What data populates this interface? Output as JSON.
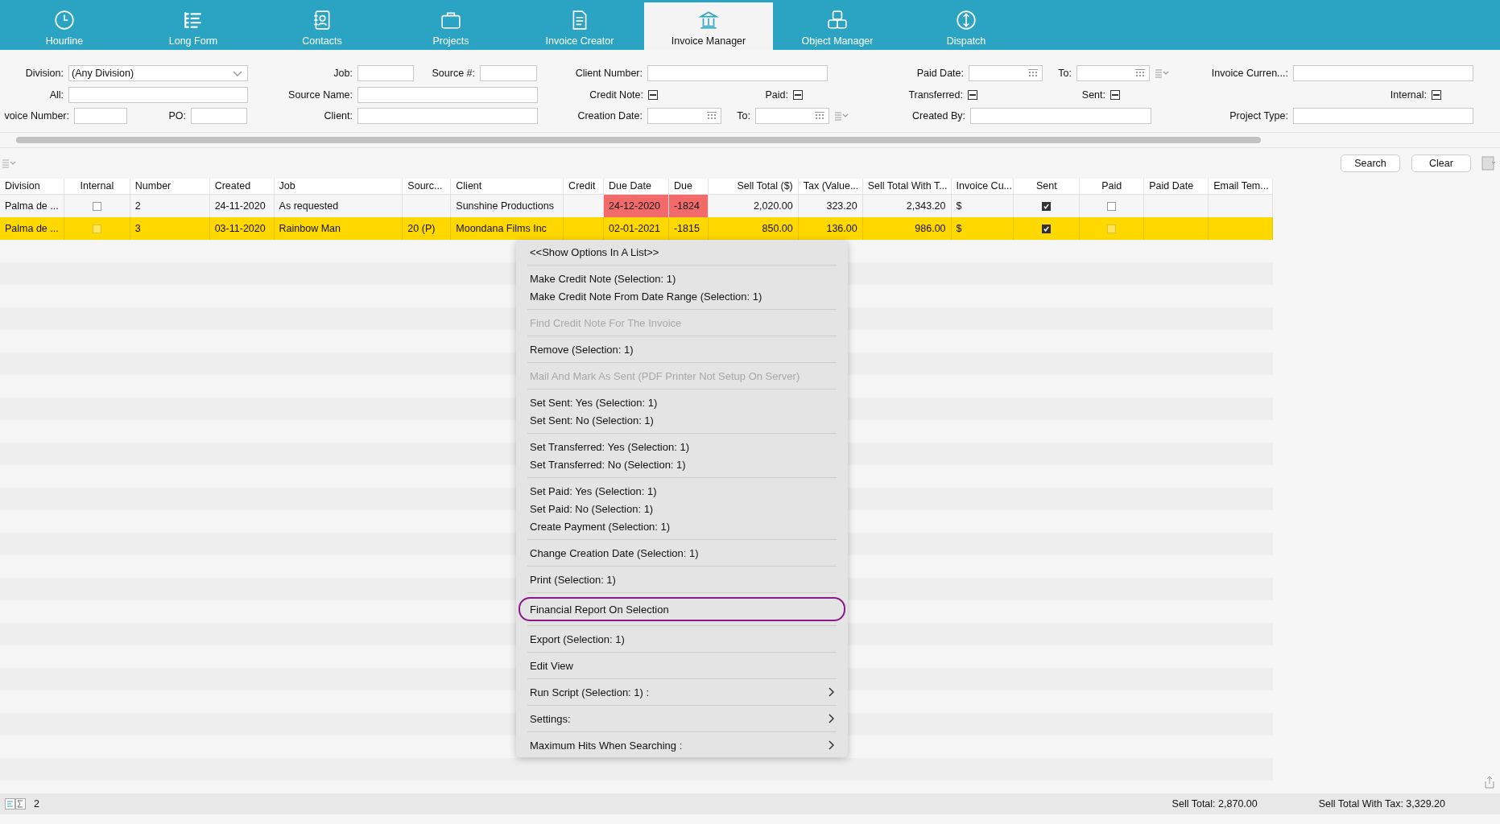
{
  "tabs": [
    {
      "label": "Hourline",
      "selected": false
    },
    {
      "label": "Long Form",
      "selected": false
    },
    {
      "label": "Contacts",
      "selected": false
    },
    {
      "label": "Projects",
      "selected": false
    },
    {
      "label": "Invoice Creator",
      "selected": false
    },
    {
      "label": "Invoice Manager",
      "selected": true
    },
    {
      "label": "Object Manager",
      "selected": false
    },
    {
      "label": "Dispatch",
      "selected": false
    }
  ],
  "filters": [
    [
      {
        "kind": "select",
        "label": "Division:",
        "value": "(Any Division)"
      },
      {
        "kind": "text",
        "label": "Job:"
      },
      {
        "kind": "text",
        "label": "Source #:"
      },
      {
        "kind": "text",
        "label": "Client Number:"
      },
      {
        "kind": "date",
        "label": "Paid Date:"
      },
      {
        "kind": "date",
        "label": "To:"
      },
      {
        "kind": "menu"
      },
      {
        "kind": "text",
        "label": "Invoice Curren...:"
      }
    ],
    [
      {
        "kind": "text",
        "label": "All:"
      },
      {
        "kind": "text",
        "label": "Source Name:"
      },
      {
        "kind": "check",
        "label": "Credit Note:",
        "indeterminate": true
      },
      {
        "kind": "check",
        "label": "Paid:",
        "indeterminate": true
      },
      {
        "kind": "check",
        "label": "Transferred:",
        "indeterminate": true
      },
      {
        "kind": "check",
        "label": "Sent:",
        "indeterminate": true
      },
      {
        "kind": "check",
        "label": "Internal:",
        "indeterminate": true
      }
    ],
    [
      {
        "kind": "text",
        "label": "voice Number:"
      },
      {
        "kind": "text",
        "label": "PO:"
      },
      {
        "kind": "text",
        "label": "Client:"
      },
      {
        "kind": "date",
        "label": "Creation Date:"
      },
      {
        "kind": "date",
        "label": "To:"
      },
      {
        "kind": "menu"
      },
      {
        "kind": "text",
        "label": "Created By:"
      },
      {
        "kind": "text",
        "label": "Project Type:"
      }
    ]
  ],
  "buttons": [
    "Search",
    "Clear"
  ],
  "table": {
    "columns": [
      {
        "label": "Division",
        "kind": "text"
      },
      {
        "label": "Internal",
        "kind": "check"
      },
      {
        "label": "Number",
        "kind": "text"
      },
      {
        "label": "Created",
        "kind": "text"
      },
      {
        "label": "Job",
        "kind": "text"
      },
      {
        "label": "Sourc...",
        "kind": "text"
      },
      {
        "label": "Client",
        "kind": "text"
      },
      {
        "label": "Credit",
        "kind": "text"
      },
      {
        "label": "Due Date",
        "kind": "due"
      },
      {
        "label": "Due",
        "kind": "due"
      },
      {
        "label": "Sell Total ($)",
        "kind": "num"
      },
      {
        "label": "Tax (Value...",
        "kind": "num"
      },
      {
        "label": "Sell Total With T...",
        "kind": "num"
      },
      {
        "label": "Invoice Cu...",
        "kind": "text"
      },
      {
        "label": "Sent",
        "kind": "check"
      },
      {
        "label": "Paid",
        "kind": "check"
      },
      {
        "label": "Paid Date",
        "kind": "text"
      },
      {
        "label": "Email Tem...",
        "kind": "text"
      }
    ],
    "rows": [
      {
        "selected": false,
        "overdue": true,
        "cells": [
          "Palma de ...",
          false,
          "2",
          "24-11-2020",
          "As requested",
          null,
          "Sunshine Productions",
          null,
          "24-12-2020",
          "-1824",
          "2,020.00",
          "323.20",
          "2,343.20",
          "$",
          true,
          false,
          null,
          null
        ]
      },
      {
        "selected": true,
        "overdue": true,
        "cells": [
          "Palma de ...",
          false,
          "3",
          "03-11-2020",
          "Rainbow Man",
          "20 (P)",
          "Moondana Films Inc",
          null,
          "02-01-2021",
          "-1815",
          "850.00",
          "136.00",
          "986.00",
          "$",
          true,
          false,
          null,
          null
        ]
      }
    ]
  },
  "context_menu": [
    {
      "kind": "item",
      "label": "<<Show Options In A List>>",
      "disabled": false
    },
    {
      "kind": "separator"
    },
    {
      "kind": "item",
      "label": "Make Credit Note (Selection: 1)",
      "disabled": false
    },
    {
      "kind": "item",
      "label": "Make Credit Note From Date Range (Selection: 1)",
      "disabled": false
    },
    {
      "kind": "separator"
    },
    {
      "kind": "item",
      "label": "Find Credit Note For The Invoice",
      "disabled": true
    },
    {
      "kind": "separator"
    },
    {
      "kind": "item",
      "label": "Remove (Selection: 1)",
      "disabled": false
    },
    {
      "kind": "separator"
    },
    {
      "kind": "item",
      "label": "Mail And Mark As Sent (PDF Printer Not Setup On Server)",
      "disabled": true
    },
    {
      "kind": "separator"
    },
    {
      "kind": "item",
      "label": "Set Sent: Yes (Selection: 1)",
      "disabled": false
    },
    {
      "kind": "item",
      "label": "Set Sent: No (Selection: 1)",
      "disabled": false
    },
    {
      "kind": "separator"
    },
    {
      "kind": "item",
      "label": "Set Transferred: Yes (Selection: 1)",
      "disabled": false
    },
    {
      "kind": "item",
      "label": "Set Transferred: No (Selection: 1)",
      "disabled": false
    },
    {
      "kind": "separator"
    },
    {
      "kind": "item",
      "label": "Set Paid: Yes (Selection: 1)",
      "disabled": false
    },
    {
      "kind": "item",
      "label": "Set Paid: No (Selection: 1)",
      "disabled": false
    },
    {
      "kind": "item",
      "label": "Create Payment (Selection: 1)",
      "disabled": false
    },
    {
      "kind": "separator"
    },
    {
      "kind": "item",
      "label": "Change Creation Date (Selection: 1)",
      "disabled": false
    },
    {
      "kind": "separator"
    },
    {
      "kind": "item",
      "label": "Print (Selection: 1)",
      "disabled": false
    },
    {
      "kind": "separator"
    },
    {
      "kind": "item",
      "label": "Financial Report On Selection",
      "disabled": false,
      "circled": true
    },
    {
      "kind": "separator"
    },
    {
      "kind": "item",
      "label": "Export (Selection: 1)",
      "disabled": false
    },
    {
      "kind": "separator"
    },
    {
      "kind": "item",
      "label": "Edit View",
      "disabled": false
    },
    {
      "kind": "separator"
    },
    {
      "kind": "item",
      "label": "Run Script (Selection: 1) :",
      "disabled": false,
      "submenu": true
    },
    {
      "kind": "separator"
    },
    {
      "kind": "item",
      "label": "Settings:",
      "disabled": false,
      "submenu": true
    },
    {
      "kind": "separator"
    },
    {
      "kind": "item",
      "label": "Maximum Hits When Searching :",
      "disabled": false,
      "submenu": true
    }
  ],
  "status_bar": {
    "count": "2",
    "sell_total": "Sell Total: 2,870.00",
    "sell_total_tax": "Sell Total With Tax: 3,329.20"
  }
}
